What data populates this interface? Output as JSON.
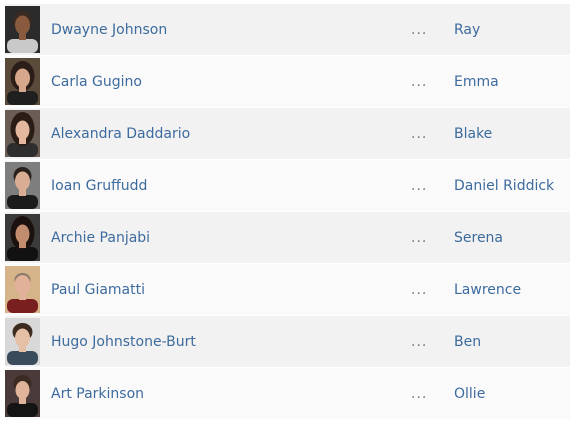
{
  "cast": [
    {
      "actor": "Dwayne Johnson",
      "separator": "...",
      "character": "Ray",
      "avatar_icon": "actor-headshot-icon",
      "tones": {
        "bg": "#2b2b2b",
        "skin": "#8a5a3e",
        "hair": "#3a2a22",
        "shirt": "#c9c9c9"
      }
    },
    {
      "actor": "Carla Gugino",
      "separator": "...",
      "character": "Emma",
      "avatar_icon": "actor-headshot-icon",
      "tones": {
        "bg": "#5a4a3a",
        "skin": "#d7a78b",
        "hair": "#2b1d17",
        "shirt": "#1f1f1f"
      }
    },
    {
      "actor": "Alexandra Daddario",
      "separator": "...",
      "character": "Blake",
      "avatar_icon": "actor-headshot-icon",
      "tones": {
        "bg": "#6a5d55",
        "skin": "#e4b79f",
        "hair": "#2a1d16",
        "shirt": "#2e2e2e"
      }
    },
    {
      "actor": "Ioan Gruffudd",
      "separator": "...",
      "character": "Daniel Riddick",
      "avatar_icon": "actor-headshot-icon",
      "tones": {
        "bg": "#7e7e7e",
        "skin": "#d9ad93",
        "hair": "#2a211c",
        "shirt": "#1b1b1b"
      }
    },
    {
      "actor": "Archie Panjabi",
      "separator": "...",
      "character": "Serena",
      "avatar_icon": "actor-headshot-icon",
      "tones": {
        "bg": "#3a3a3a",
        "skin": "#c18d6e",
        "hair": "#1b1210",
        "shirt": "#111111"
      }
    },
    {
      "actor": "Paul Giamatti",
      "separator": "...",
      "character": "Lawrence",
      "avatar_icon": "actor-headshot-icon",
      "tones": {
        "bg": "#d6b48a",
        "skin": "#e2b19a",
        "hair": "#8a7a6a",
        "shirt": "#7a1f1f"
      }
    },
    {
      "actor": "Hugo Johnstone-Burt",
      "separator": "...",
      "character": "Ben",
      "avatar_icon": "actor-headshot-icon",
      "tones": {
        "bg": "#d8d8d8",
        "skin": "#e6c0a6",
        "hair": "#3d2b1f",
        "shirt": "#3a4b5c"
      }
    },
    {
      "actor": "Art Parkinson",
      "separator": "...",
      "character": "Ollie",
      "avatar_icon": "actor-headshot-icon",
      "tones": {
        "bg": "#4a3a3a",
        "skin": "#e0b49a",
        "hair": "#3a2a22",
        "shirt": "#141414"
      }
    }
  ]
}
